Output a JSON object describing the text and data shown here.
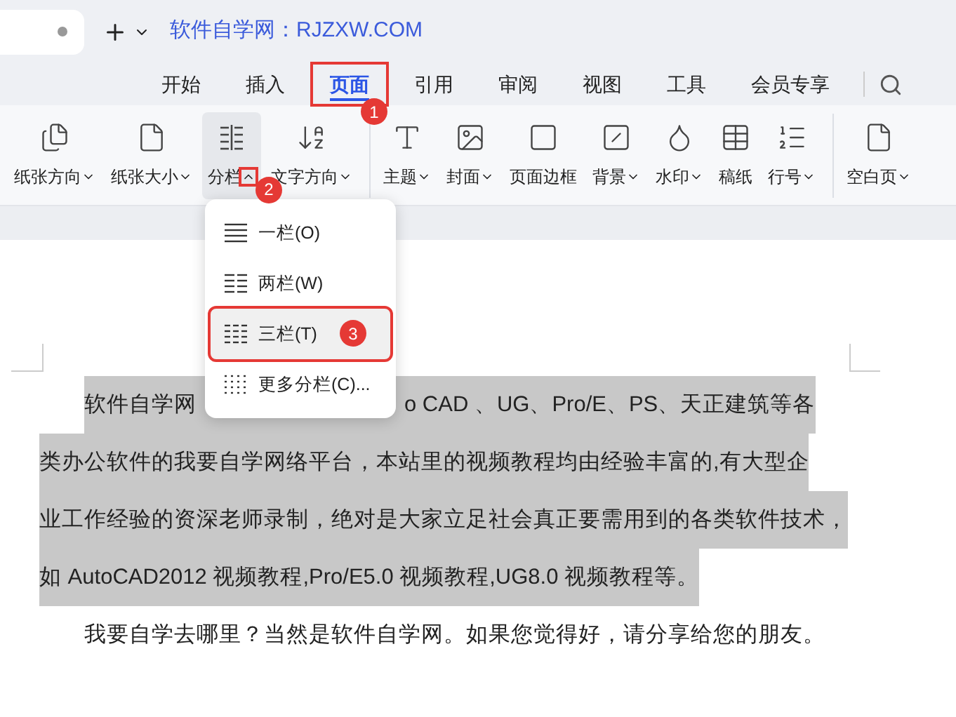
{
  "title_bar": {
    "site_title": "软件自学网：RJZXW.COM"
  },
  "tabs": [
    {
      "label": "开始",
      "selected": false
    },
    {
      "label": "插入",
      "selected": false
    },
    {
      "label": "页面",
      "selected": true,
      "callout": "1"
    },
    {
      "label": "引用",
      "selected": false
    },
    {
      "label": "审阅",
      "selected": false
    },
    {
      "label": "视图",
      "selected": false
    },
    {
      "label": "工具",
      "selected": false
    },
    {
      "label": "会员专享",
      "selected": false
    }
  ],
  "ribbon": {
    "groups": [
      {
        "items": [
          {
            "label": "纸张方向",
            "dropdown": true,
            "active": false
          },
          {
            "label": "纸张大小",
            "dropdown": true,
            "active": false
          },
          {
            "label": "分栏",
            "dropdown": true,
            "expanded": true,
            "active": true,
            "callout": "2"
          },
          {
            "label": "文字方向",
            "dropdown": true,
            "active": false
          }
        ]
      },
      {
        "items": [
          {
            "label": "主题",
            "dropdown": true,
            "active": false
          },
          {
            "label": "封面",
            "dropdown": true,
            "active": false
          },
          {
            "label": "页面边框",
            "dropdown": false,
            "active": false
          },
          {
            "label": "背景",
            "dropdown": true,
            "active": false
          },
          {
            "label": "水印",
            "dropdown": true,
            "active": false
          },
          {
            "label": "稿纸",
            "dropdown": false,
            "active": false
          },
          {
            "label": "行号",
            "dropdown": true,
            "active": false
          }
        ]
      },
      {
        "items": [
          {
            "label": "空白页",
            "dropdown": true,
            "active": false
          }
        ]
      }
    ]
  },
  "columns_menu": {
    "items": [
      {
        "label": "一栏(O)",
        "selected": false
      },
      {
        "label": "两栏(W)",
        "selected": false
      },
      {
        "label": "三栏(T)",
        "selected": true,
        "callout": "3"
      },
      {
        "label": "更多分栏(C)...",
        "selected": false
      }
    ]
  },
  "document": {
    "paragraphs": [
      {
        "selected": true,
        "lines": [
          [
            "软件自学网",
            "o CAD 、UG、Pro/E、PS、天正建筑等各"
          ],
          [
            "类办公软件的我要自学网络平台，本站里的视频教程均由经验丰富的,有大型企"
          ],
          [
            "业工作经验的资深老师录制，绝对是大家立足社会真正要需用到的各类软件技术，"
          ],
          [
            "如 AutoCAD2012 视频教程,Pro/E5.0 视频教程,UG8.0 视频教程等。"
          ]
        ]
      },
      {
        "selected": false,
        "lines": [
          [
            "我要自学去哪里？当然是软件自学网。如果您觉得好，请分享给您的朋友。"
          ]
        ]
      }
    ]
  }
}
